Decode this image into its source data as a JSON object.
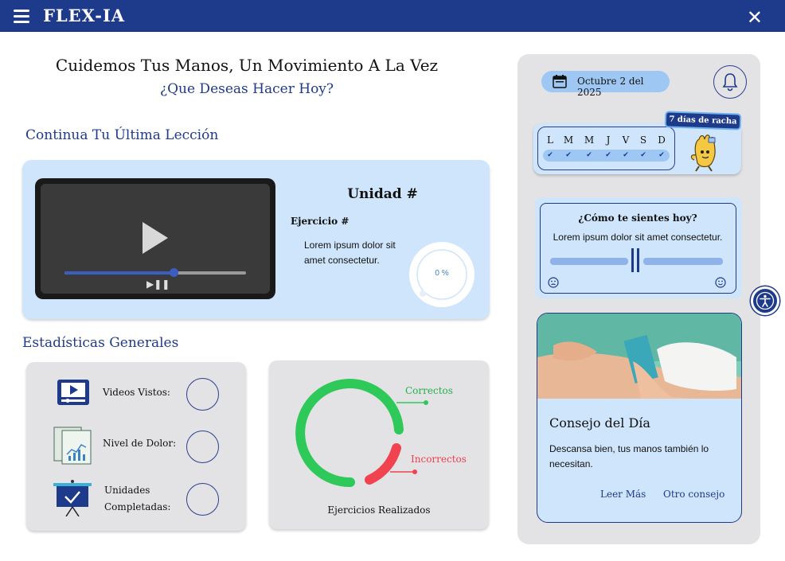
{
  "header": {
    "brand": "FLEX-IA",
    "menu_icon": "hamburger-icon",
    "close_icon": "close-icon"
  },
  "hero": {
    "title": "Cuidemos Tus Manos, Un Movimiento A La Vez",
    "subtitle": "¿Que Deseas Hacer Hoy?"
  },
  "last_lesson": {
    "section_title": "Continua Tu Última Lección",
    "video_progress": 0.6,
    "unit": "Unidad #",
    "exercise": "Ejercicio #",
    "description": "Lorem ipsum dolor sit amet consectetur.",
    "progress_label": "0 %",
    "progress_value": 0
  },
  "stats": {
    "section_title": "Estadísticas Generales",
    "rows": [
      {
        "label": "Videos Vistos:",
        "icon": "video-screen-icon"
      },
      {
        "label": "Nivel de Dolor:",
        "icon": "chart-document-icon"
      },
      {
        "label_line1": "Unidades",
        "label_line2": "Completadas:",
        "icon": "presentation-board-icon"
      }
    ]
  },
  "exercises_chart": {
    "caption": "Ejercicios Realizados",
    "correct_label": "Correctos",
    "incorrect_label": "Incorrectos",
    "colors": {
      "correct": "#2fc95a",
      "incorrect": "#f0424f"
    }
  },
  "sidebar": {
    "date": "Octubre 2 del 2025",
    "calendar_icon": "calendar-icon",
    "bell_icon": "bell-icon",
    "streak_badge": "7 días de racha",
    "days": [
      "L",
      "M",
      "M",
      "J",
      "V",
      "S",
      "D"
    ],
    "mascot": "hand-mascot-icon",
    "mood_question": "¿Cómo te sientes hoy?",
    "mood_desc": "Lorem ipsum dolor sit amet consectetur.",
    "mood_value": 0.5,
    "tip_title": "Consejo del Día",
    "tip_text": "Descansa bien, tus manos también lo necesitan.",
    "read_more": "Leer Más",
    "other_tip": "Otro consejo"
  },
  "accessibility_icon": "accessibility-icon",
  "colors": {
    "primary": "#1e3a8a",
    "light_blue": "#cfe5fb",
    "panel_gray": "#e3e3e6"
  }
}
